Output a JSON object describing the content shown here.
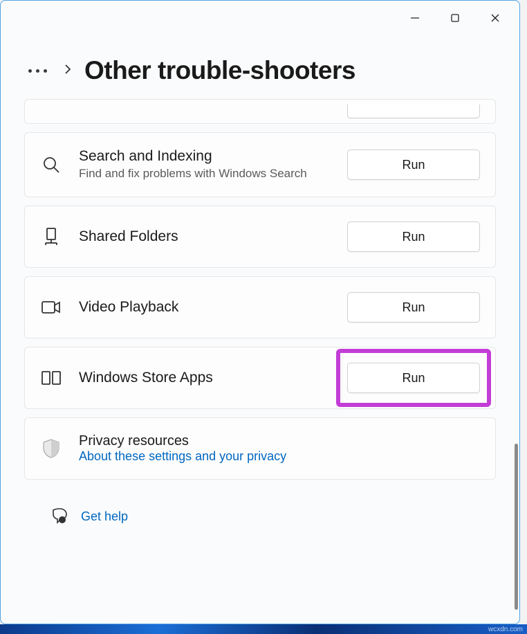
{
  "header": {
    "title": "Other trouble-shooters"
  },
  "items": [
    {
      "title": "Search and Indexing",
      "desc": "Find and fix problems with Windows Search",
      "button": "Run"
    },
    {
      "title": "Shared Folders",
      "desc": "",
      "button": "Run"
    },
    {
      "title": "Video Playback",
      "desc": "",
      "button": "Run"
    },
    {
      "title": "Windows Store Apps",
      "desc": "",
      "button": "Run"
    }
  ],
  "privacy": {
    "title": "Privacy resources",
    "link": "About these settings and your privacy"
  },
  "help": {
    "label": "Get help"
  },
  "watermark": "wcxdn.com"
}
